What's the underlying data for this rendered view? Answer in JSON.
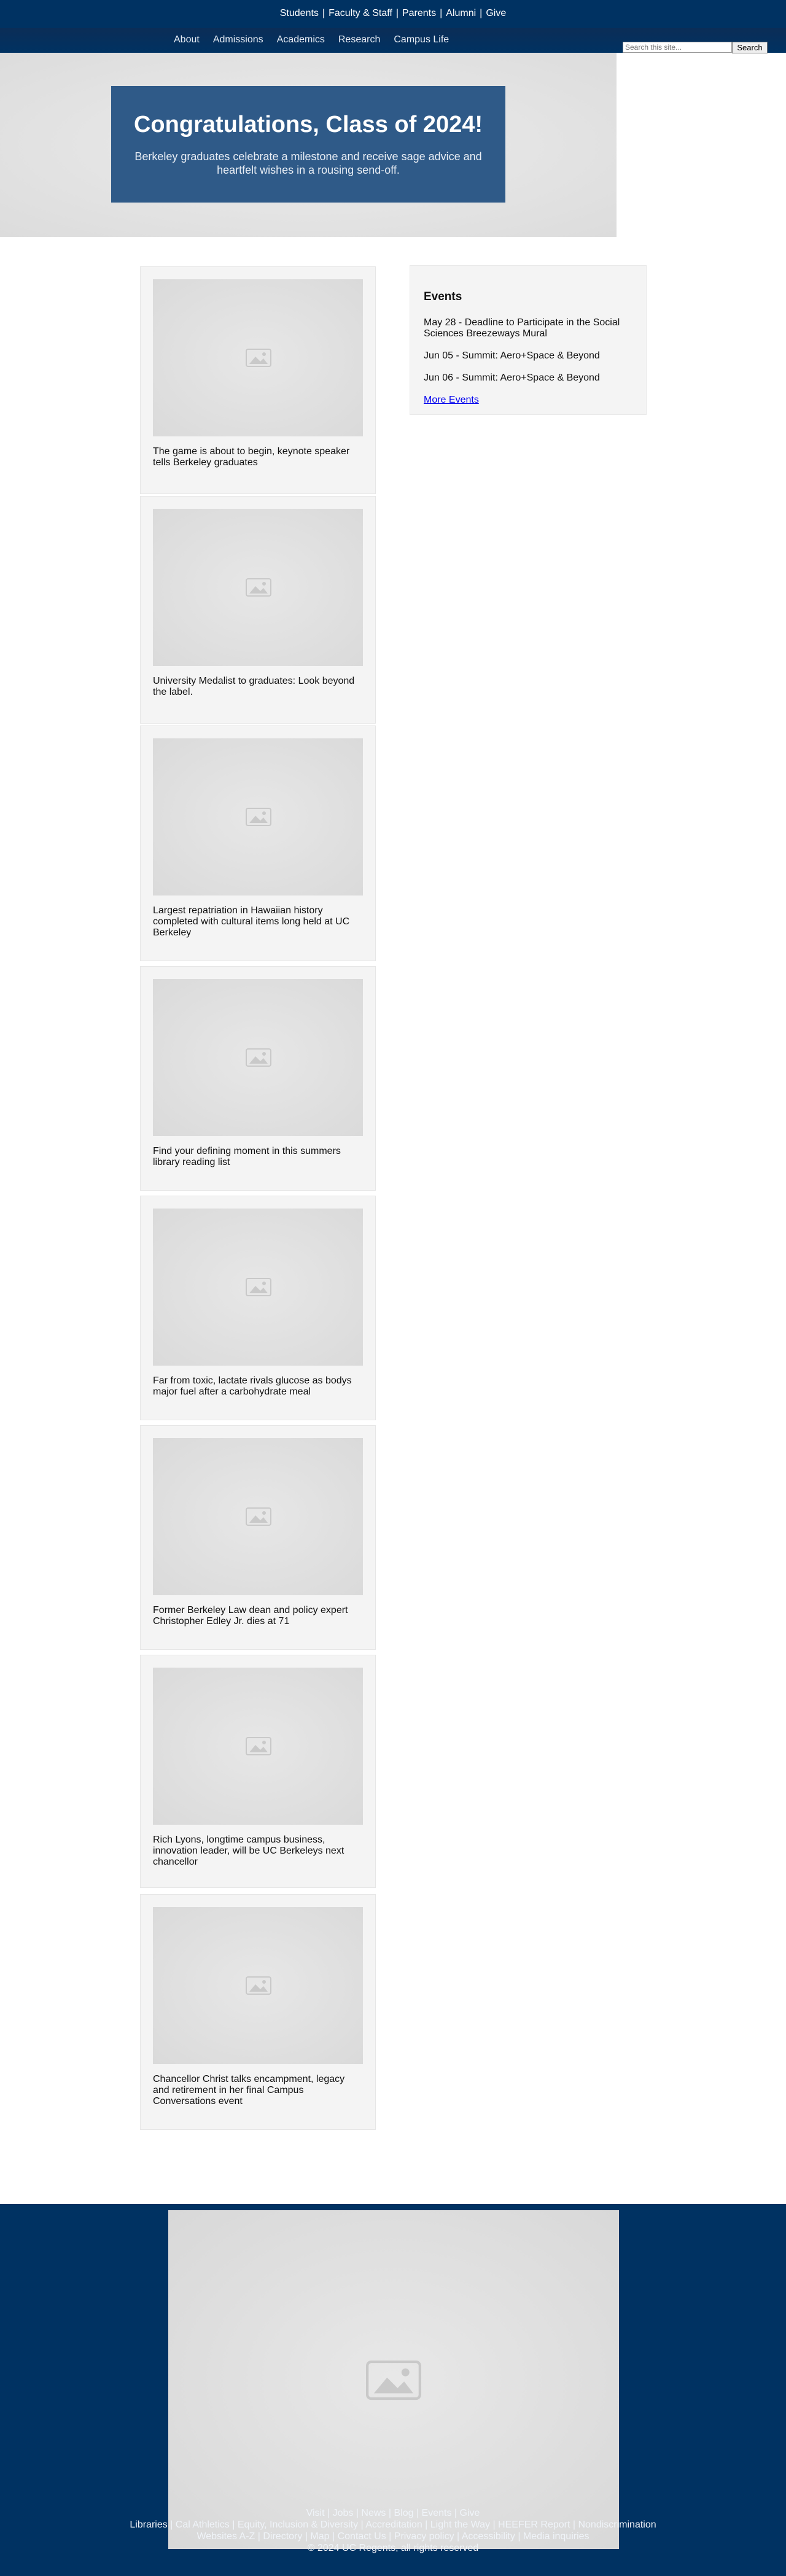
{
  "topbar": {
    "links": [
      "Students",
      "Faculty & Staff",
      "Parents",
      "Alumni",
      "Give"
    ]
  },
  "nav": {
    "items": [
      "About",
      "Admissions",
      "Academics",
      "Research",
      "Campus Life"
    ]
  },
  "search": {
    "placeholder": "Search this site...",
    "button_label": "Search"
  },
  "hero": {
    "title": "Congratulations, Class of 2024!",
    "subtitle": "Berkeley graduates celebrate a milestone and receive sage advice and heartfelt wishes in a rousing send-off."
  },
  "news": [
    {
      "caption": "The game is about to begin, keynote speaker tells Berkeley graduates"
    },
    {
      "caption": "University Medalist to graduates: Look beyond the label."
    },
    {
      "caption": "Largest repatriation in Hawaiian history completed with cultural items long held at UC Berkeley"
    },
    {
      "caption": "Find your defining moment in this summers library reading list"
    },
    {
      "caption": "Far from toxic, lactate rivals glucose as bodys major fuel after a carbohydrate meal"
    },
    {
      "caption": "Former Berkeley Law dean and policy expert Christopher Edley Jr. dies at 71"
    },
    {
      "caption": "Rich Lyons, longtime campus business, innovation leader, will be UC Berkeleys next chancellor"
    },
    {
      "caption": "Chancellor Christ talks encampment, legacy and retirement in her final Campus Conversations event"
    }
  ],
  "events": {
    "title": "Events",
    "items": [
      "May 28 - Deadline to Participate in the Social Sciences Breezeways Mural",
      "Jun 05 - Summit: Aero+Space & Beyond",
      "Jun 06 - Summit: Aero+Space & Beyond"
    ],
    "more_label": "More Events"
  },
  "footer": {
    "line1": "Visit | Jobs | News | Blog | Events | Give",
    "line2": "Libraries | Cal Athletics | Equity, Inclusion & Diversity | Accreditation | Light the Way | HEEFER Report | Nondiscrimination",
    "line3": "Websites A-Z | Directory | Map | Contact Us | Privacy policy | Accessibility | Media inquiries",
    "copyright": "© 2024 UC Regents, all rights reserved"
  },
  "colors": {
    "brand_blue": "#003262",
    "hero_box": "#2f5a88",
    "card_bg": "#f4f4f4"
  },
  "icons": {
    "placeholder": "image-placeholder-icon"
  }
}
